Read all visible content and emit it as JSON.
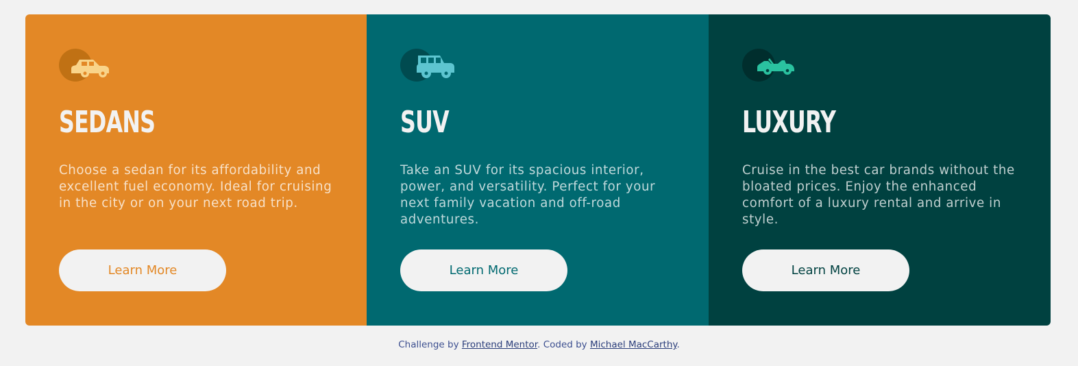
{
  "cards": [
    {
      "title": "SEDANS",
      "description": "Choose a sedan for its affordability and excellent fuel economy. Ideal for cruising in the city or on your next road trip.",
      "button_label": "Learn More",
      "icon": "sedan-car-icon",
      "background": "#e38826",
      "button_text_color": "#e38826",
      "icon_circle_color": "#c07114",
      "icon_color": "#f9d48a"
    },
    {
      "title": "SUV",
      "description": "Take an SUV for its spacious interior, power, and versatility. Perfect for your next family vacation and off-road adventures.",
      "button_label": "Learn More",
      "icon": "suv-car-icon",
      "background": "#006970",
      "button_text_color": "#006970",
      "icon_circle_color": "#004b50",
      "icon_color": "#5dc5d0"
    },
    {
      "title": "LUXURY",
      "description": "Cruise in the best car brands without the bloated prices. Enjoy the enhanced comfort of a luxury rental and arrive in style.",
      "button_label": "Learn More",
      "icon": "luxury-car-icon",
      "background": "#004140",
      "button_text_color": "#004140",
      "icon_circle_color": "#002e2d",
      "icon_color": "#2ac2a0"
    }
  ],
  "footer": {
    "prefix": "Challenge by ",
    "link1": "Frontend Mentor",
    "middle": ". Coded by ",
    "link2": "Michael MacCarthy",
    "suffix": "."
  }
}
